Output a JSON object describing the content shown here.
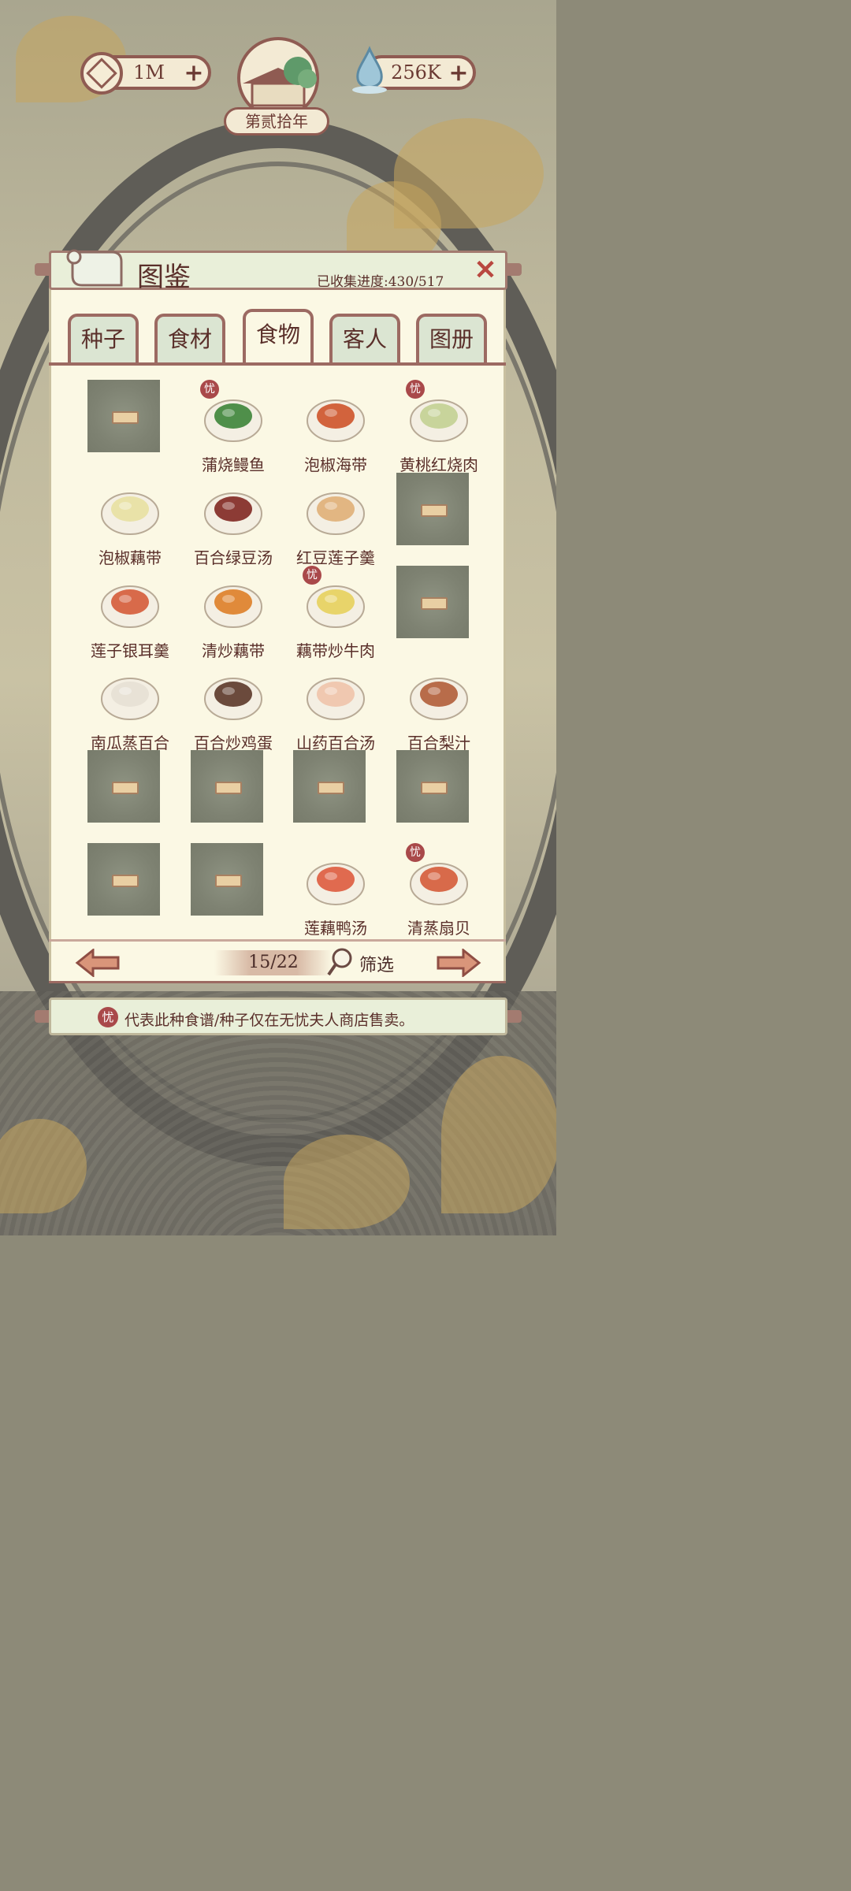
{
  "hud": {
    "coins": "1M",
    "water": "256K",
    "year": "第贰拾年",
    "plus": "+"
  },
  "panel": {
    "title": "图鉴",
    "progress": "已收集进度:430/517",
    "close": "✕"
  },
  "tabs": [
    "种子",
    "食材",
    "食物",
    "客人",
    "图册"
  ],
  "active_tab": "食物",
  "badge_char": "忧",
  "grid": [
    {
      "name": "",
      "locked": true
    },
    {
      "name": "蒲烧鳗鱼",
      "locked": false,
      "badge": true,
      "icon": "grilled-eel-icon"
    },
    {
      "name": "泡椒海带",
      "locked": false,
      "badge": false,
      "icon": "kelp-dish-icon"
    },
    {
      "name": "黄桃红烧肉",
      "locked": false,
      "badge": true,
      "icon": "braised-pork-icon"
    },
    {
      "name": "泡椒藕带",
      "locked": false,
      "badge": false,
      "icon": "lotus-shoot-dish-icon"
    },
    {
      "name": "百合绿豆汤",
      "locked": false,
      "badge": false,
      "icon": "mung-bean-soup-icon"
    },
    {
      "name": "红豆莲子羹",
      "locked": false,
      "badge": false,
      "icon": "red-bean-soup-icon"
    },
    {
      "name": "",
      "locked": true
    },
    {
      "name": "莲子银耳羹",
      "locked": false,
      "badge": false,
      "icon": "lotus-seed-soup-icon"
    },
    {
      "name": "清炒藕带",
      "locked": false,
      "badge": false,
      "icon": "stir-fry-icon"
    },
    {
      "name": "藕带炒牛肉",
      "locked": false,
      "badge": true,
      "icon": "beef-stir-fry-icon"
    },
    {
      "name": "",
      "locked": true
    },
    {
      "name": "南瓜蒸百合",
      "locked": false,
      "badge": false,
      "icon": "pumpkin-dish-icon"
    },
    {
      "name": "百合炒鸡蛋",
      "locked": false,
      "badge": false,
      "icon": "egg-dish-icon"
    },
    {
      "name": "山药百合汤",
      "locked": false,
      "badge": false,
      "icon": "yam-soup-icon"
    },
    {
      "name": "百合梨汁",
      "locked": false,
      "badge": false,
      "icon": "pear-juice-icon"
    },
    {
      "name": "",
      "locked": true
    },
    {
      "name": "",
      "locked": true
    },
    {
      "name": "",
      "locked": true
    },
    {
      "name": "",
      "locked": true
    },
    {
      "name": "",
      "locked": true
    },
    {
      "name": "",
      "locked": true
    },
    {
      "name": "莲藕鸭汤",
      "locked": false,
      "badge": false,
      "icon": "duck-soup-icon"
    },
    {
      "name": "清蒸扇贝",
      "locked": false,
      "badge": true,
      "icon": "steamed-scallop-icon"
    }
  ],
  "pager": {
    "page": "15/22",
    "filter": "筛选"
  },
  "note": "代表此种食谱/种子仅在无忧夫人商店售卖。",
  "colors": {
    "panel": "#fbf8e4",
    "border": "#9c6a62",
    "text": "#5a2f2a",
    "badge": "#a9494a",
    "lockedSlot": "#80846f"
  }
}
